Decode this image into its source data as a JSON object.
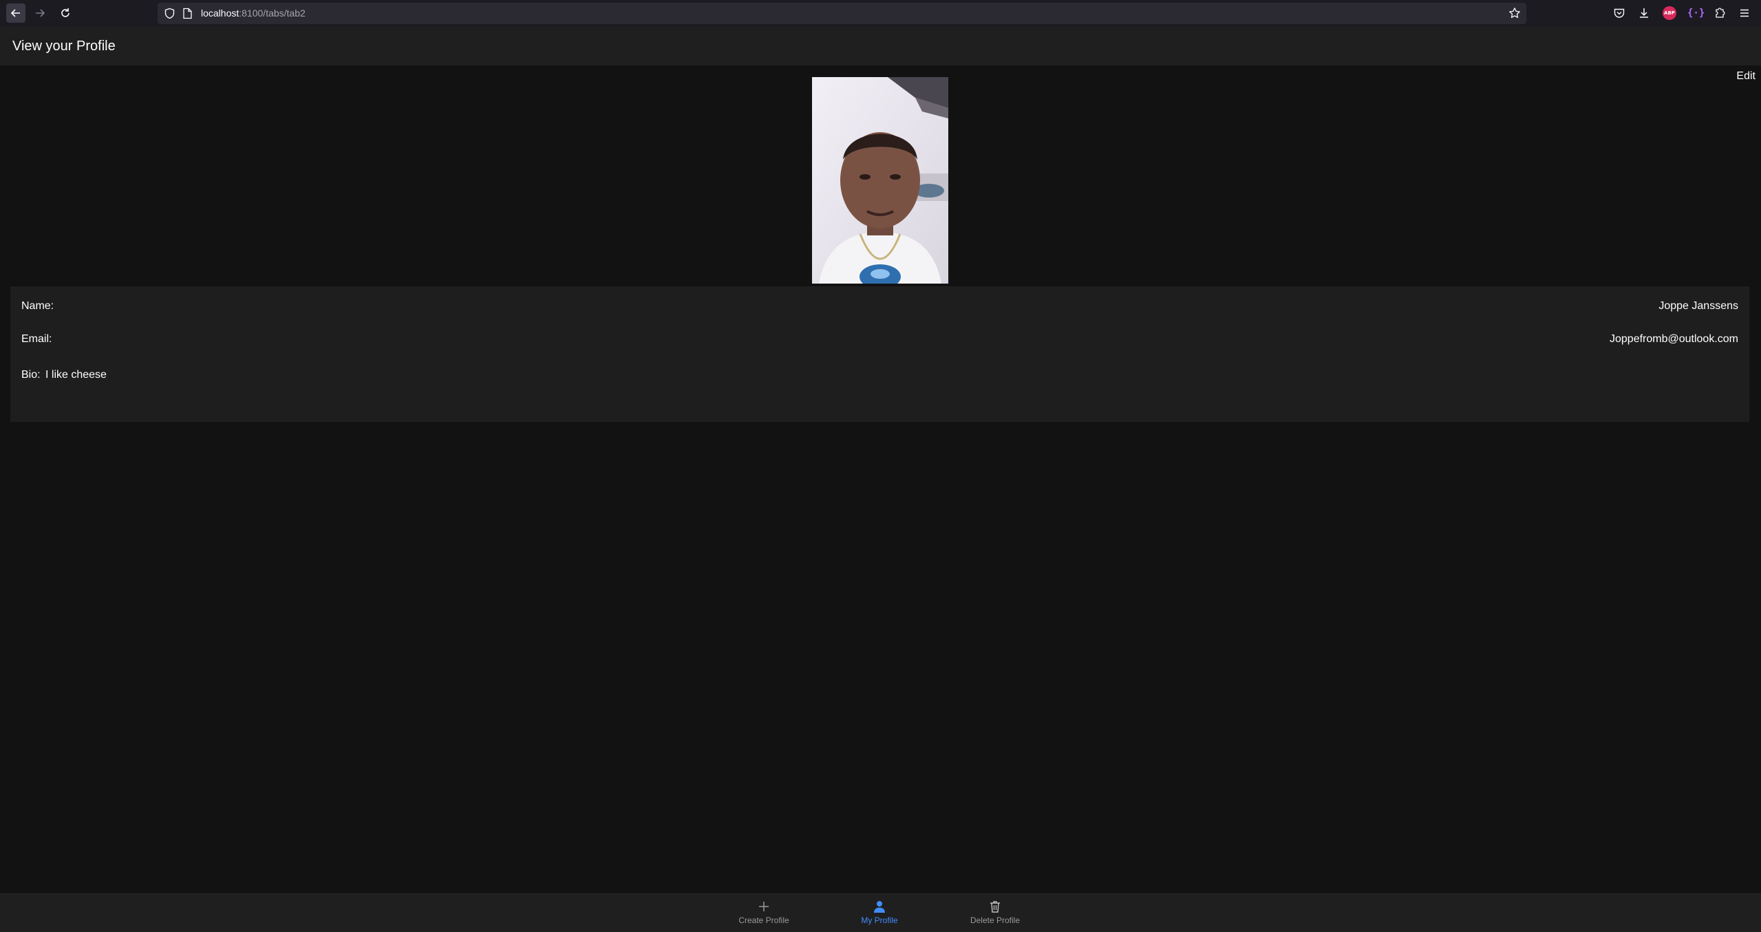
{
  "browser": {
    "url_host": "localhost",
    "url_path": ":8100/tabs/tab2",
    "icons": [
      "back-arrow-icon",
      "forward-arrow-icon",
      "reload-icon",
      "shield-icon",
      "page-icon",
      "star-icon",
      "pocket-icon",
      "download-icon",
      "adblock-icon",
      "extension-brackets-icon",
      "extensions-puzzle-icon",
      "menu-icon"
    ],
    "abp_label": "ABP",
    "ext_label": "{·}"
  },
  "header": {
    "title": "View your Profile"
  },
  "content": {
    "edit_label": "Edit",
    "photo_alt": "Profile photo",
    "profile": {
      "name_label": "Name:",
      "name_value": "Joppe Janssens",
      "email_label": "Email:",
      "email_value": "Joppefromb@outlook.com",
      "bio_label": "Bio:",
      "bio_value": "I like cheese"
    }
  },
  "tabs": [
    {
      "label": "Create Profile",
      "icon": "add-icon",
      "active": false
    },
    {
      "label": "My Profile",
      "icon": "person-icon",
      "active": true
    },
    {
      "label": "Delete Profile",
      "icon": "trash-icon",
      "active": false
    }
  ],
  "colors": {
    "background": "#121212",
    "toolbar": "#1f1f1f",
    "card": "#1e1e1e",
    "accent": "#428cff",
    "inactive_tab": "#9a9a9a"
  }
}
